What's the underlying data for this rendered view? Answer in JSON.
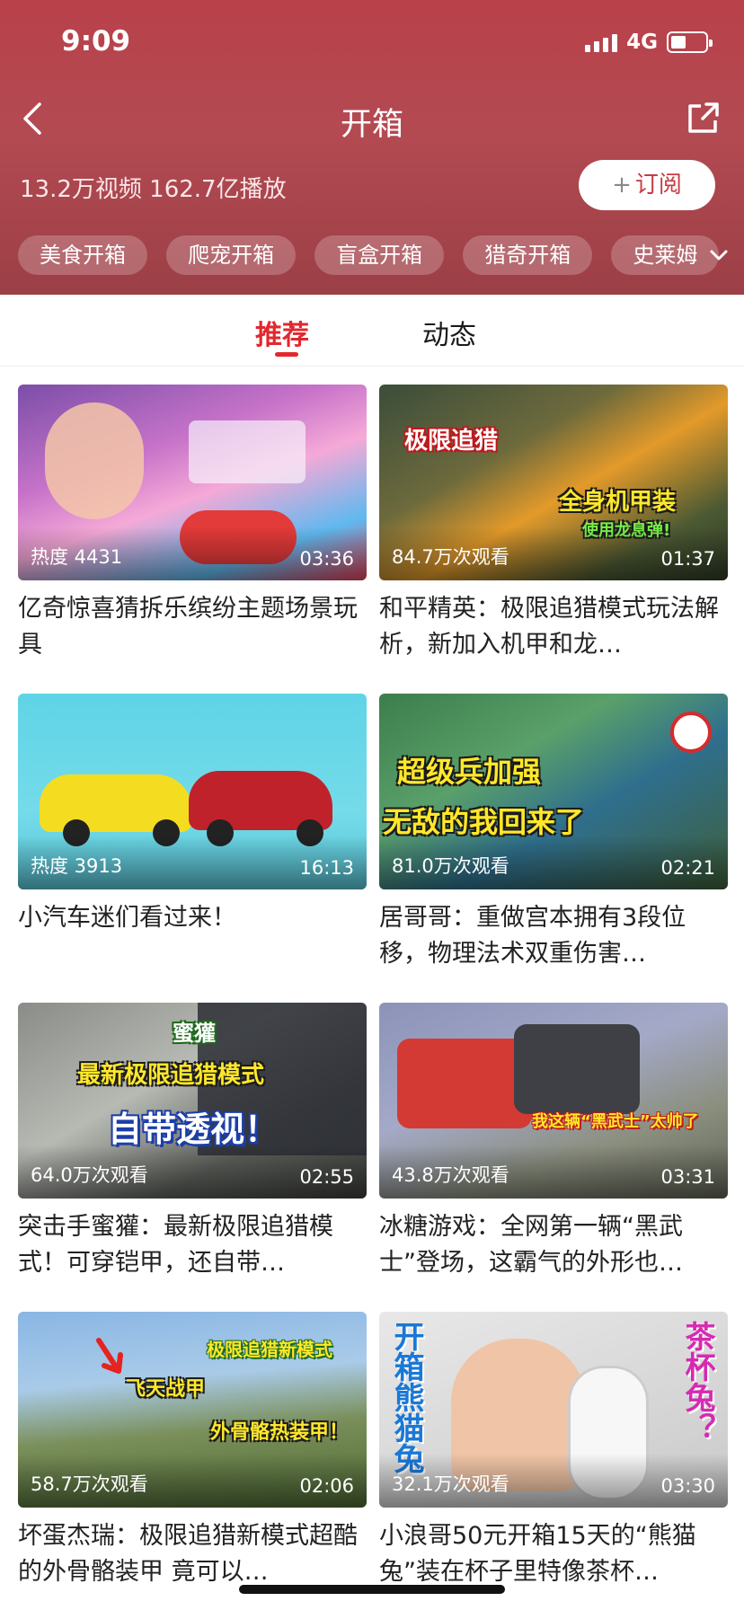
{
  "status_bar": {
    "time": "9:09",
    "network": "4G"
  },
  "header": {
    "title": "开箱",
    "stats": "13.2万视频 162.7亿播放",
    "subscribe_label": "订阅",
    "subscribe_plus": "+",
    "tags": [
      "美食开箱",
      "爬宠开箱",
      "盲盒开箱",
      "猎奇开箱",
      "史莱姆"
    ]
  },
  "tabs": [
    {
      "label": "推荐",
      "active": true
    },
    {
      "label": "动态",
      "active": false
    }
  ],
  "videos": [
    {
      "title": "亿奇惊喜猜拆乐缤纷主题场景玩具",
      "meta_left": "热度 4431",
      "duration": "03:36"
    },
    {
      "title": "和平精英：极限追猎模式玩法解析，新加入机甲和龙…",
      "meta_left": "84.7万次观看",
      "duration": "01:37",
      "overlays": [
        "极限追猎",
        "全身机甲装",
        "使用龙息弹!"
      ]
    },
    {
      "title": "小汽车迷们看过来！",
      "meta_left": "热度 3913",
      "duration": "16:13"
    },
    {
      "title": "居哥哥：重做宫本拥有3段位移，物理法术双重伤害…",
      "meta_left": "81.0万次观看",
      "duration": "02:21",
      "overlays": [
        "超级兵加强",
        "无敌的我回来了"
      ]
    },
    {
      "title": "突击手蜜獾：最新极限追猎模式！可穿铠甲，还自带…",
      "meta_left": "64.0万次观看",
      "duration": "02:55",
      "overlays": [
        "蜜獾",
        "最新极限追猎模式",
        "自带透视！"
      ]
    },
    {
      "title": "冰糖游戏：全网第一辆“黑武士”登场，这霸气的外形也…",
      "meta_left": "43.8万次观看",
      "duration": "03:31",
      "overlays": [
        "我这辆“黑武士”太帅了"
      ]
    },
    {
      "title": "坏蛋杰瑞：极限追猎新模式超酷的外骨骼装甲 竟可以…",
      "meta_left": "58.7万次观看",
      "duration": "02:06",
      "overlays": [
        "极限追猎新模式",
        "飞天战甲",
        "外骨骼热装甲！"
      ]
    },
    {
      "title": "小浪哥50元开箱15天的“熊猫兔”装在杯子里特像茶杯…",
      "meta_left": "32.1万次观看",
      "duration": "03:30",
      "overlays": [
        "开箱熊猫兔",
        "茶杯兔？"
      ]
    }
  ]
}
